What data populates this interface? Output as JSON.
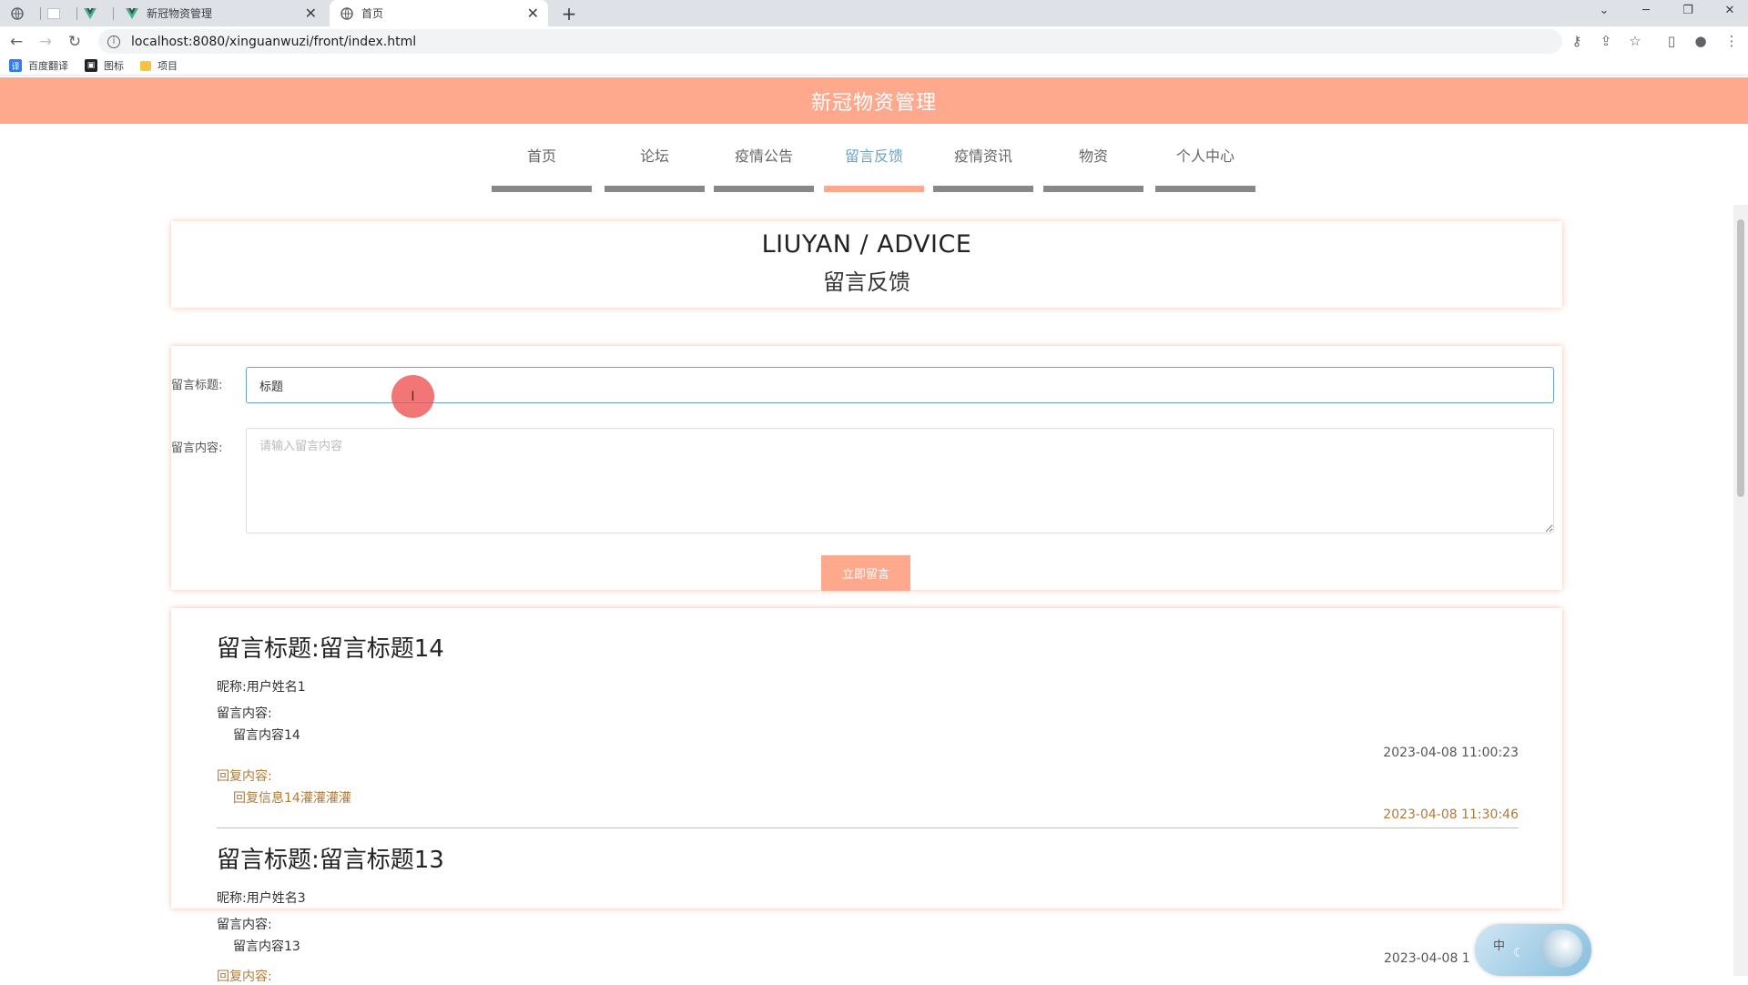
{
  "browser": {
    "tabs": [
      {
        "title": "",
        "icon": "globe-icon"
      },
      {
        "title": "",
        "icon": "blank-page-icon"
      },
      {
        "title": "",
        "icon": "vue-logo-icon"
      },
      {
        "title": "新冠物资管理",
        "icon": "vue-logo-icon"
      },
      {
        "title": "首页",
        "icon": "globe-icon",
        "active": true
      }
    ],
    "url": "localhost:8080/xinguanwuzi/front/index.html",
    "bookmarks": [
      {
        "label": "百度翻译",
        "icon": "translate-icon",
        "color": "#2f7df6"
      },
      {
        "label": "图标",
        "icon": "image-icon",
        "color": "#222222"
      },
      {
        "label": "项目",
        "icon": "folder-icon",
        "color": "#f4c542"
      }
    ]
  },
  "site": {
    "header_title": "新冠物资管理",
    "accent_color": "#fea98e",
    "nav": [
      {
        "label": "首页"
      },
      {
        "label": "论坛"
      },
      {
        "label": "疫情公告"
      },
      {
        "label": "留言反馈",
        "active": true
      },
      {
        "label": "疫情资讯"
      },
      {
        "label": "物资"
      },
      {
        "label": "个人中心"
      }
    ]
  },
  "section": {
    "title_en": "LIUYAN / ADVICE",
    "title_zh": "留言反馈"
  },
  "form": {
    "title_label": "留言标题:",
    "title_value": "标题",
    "content_label": "留言内容:",
    "content_placeholder": "请输入留言内容",
    "submit_label": "立即留言"
  },
  "messages": [
    {
      "title": "留言标题:留言标题14",
      "nickname": "昵称:用户姓名1",
      "content_label": "留言内容:",
      "content": "留言内容14",
      "time": "2023-04-08 11:00:23",
      "reply_label": "回复内容:",
      "reply": "回复信息14灌灌灌灌",
      "reply_time": "2023-04-08 11:30:46"
    },
    {
      "title": "留言标题:留言标题13",
      "nickname": "昵称:用户姓名3",
      "content_label": "留言内容:",
      "content": "留言内容13",
      "time": "2023-04-08 1",
      "reply_label": "回复内容:"
    }
  ],
  "widget": {
    "label": "中"
  }
}
